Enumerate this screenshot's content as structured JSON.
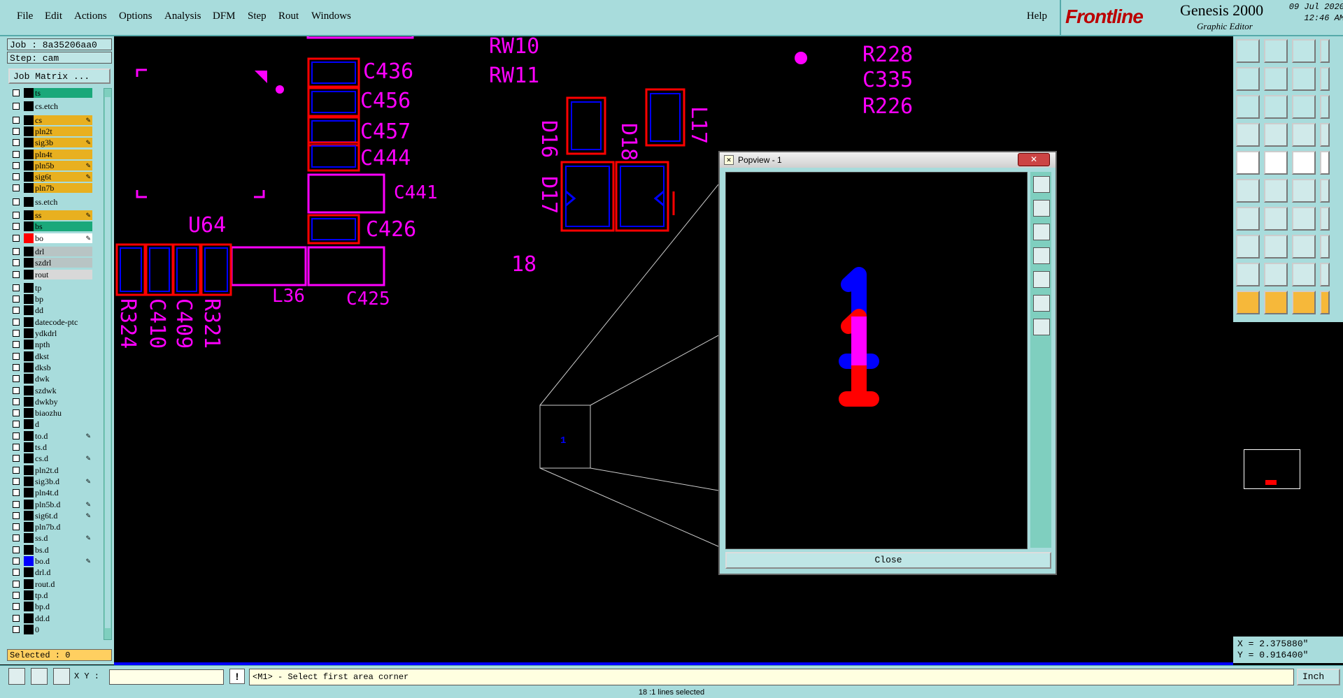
{
  "menu": [
    "File",
    "Edit",
    "Actions",
    "Options",
    "Analysis",
    "DFM",
    "Step",
    "Rout",
    "Windows"
  ],
  "help": "Help",
  "brand": {
    "logo": "Frontline",
    "title": "Genesis 2000",
    "subtitle": "Graphic Editor",
    "date": "09 Jul 2020",
    "time": "12:46 AM"
  },
  "job": {
    "job_label": "Job : 8a35206aa0",
    "step_label": "Step: cam",
    "matrix_button": "Job Matrix ..."
  },
  "layers": [
    {
      "name": "ts",
      "color": "#1aa87a",
      "sw": "#000000"
    },
    {
      "name": "cs.etch",
      "color": "#a8dcdc",
      "sw": "#000000"
    },
    {
      "name": "cs",
      "color": "#e8b020",
      "sw": "#000000",
      "edit": true
    },
    {
      "name": "pln2t",
      "color": "#e8b020",
      "sw": "#000000"
    },
    {
      "name": "sig3b",
      "color": "#e8b020",
      "sw": "#000000",
      "edit": true
    },
    {
      "name": "pln4t",
      "color": "#e8b020",
      "sw": "#000000"
    },
    {
      "name": "pln5b",
      "color": "#e8b020",
      "sw": "#000000",
      "edit": true
    },
    {
      "name": "sig6t",
      "color": "#e8b020",
      "sw": "#000000",
      "edit": true
    },
    {
      "name": "pln7b",
      "color": "#e8b020",
      "sw": "#000000"
    },
    {
      "name": "ss.etch",
      "color": "#a8dcdc",
      "sw": "#000000"
    },
    {
      "name": "ss",
      "color": "#e8b020",
      "sw": "#000000",
      "edit": true
    },
    {
      "name": "bs",
      "color": "#1aa87a",
      "sw": "#000000"
    },
    {
      "name": "bo",
      "color": "#ffffff",
      "sw": "#ff0000",
      "edit": true
    },
    {
      "name": "drl",
      "color": "#b8c4c4",
      "sw": "#000000"
    },
    {
      "name": "szdrl",
      "color": "#b8c4c4",
      "sw": "#000000"
    },
    {
      "name": "rout",
      "color": "#d8d8d8",
      "sw": "#000000"
    },
    {
      "name": "tp",
      "color": "#a8dcdc",
      "sw": "#000000"
    },
    {
      "name": "bp",
      "color": "#a8dcdc",
      "sw": "#000000"
    },
    {
      "name": "dd",
      "color": "#a8dcdc",
      "sw": "#000000"
    },
    {
      "name": "datecode-ptc",
      "color": "#a8dcdc",
      "sw": "#000000"
    },
    {
      "name": "ydkdrl",
      "color": "#a8dcdc",
      "sw": "#000000"
    },
    {
      "name": "npth",
      "color": "#a8dcdc",
      "sw": "#000000"
    },
    {
      "name": "dkst",
      "color": "#a8dcdc",
      "sw": "#000000"
    },
    {
      "name": "dksb",
      "color": "#a8dcdc",
      "sw": "#000000"
    },
    {
      "name": "dwk",
      "color": "#a8dcdc",
      "sw": "#000000"
    },
    {
      "name": "szdwk",
      "color": "#a8dcdc",
      "sw": "#000000"
    },
    {
      "name": "dwkby",
      "color": "#a8dcdc",
      "sw": "#000000"
    },
    {
      "name": "biaozhu",
      "color": "#a8dcdc",
      "sw": "#000000"
    },
    {
      "name": "d",
      "color": "#a8dcdc",
      "sw": "#000000"
    },
    {
      "name": "to.d",
      "color": "#a8dcdc",
      "sw": "#000000",
      "edit": true
    },
    {
      "name": "ts.d",
      "color": "#a8dcdc",
      "sw": "#000000"
    },
    {
      "name": "cs.d",
      "color": "#a8dcdc",
      "sw": "#000000",
      "edit": true
    },
    {
      "name": "pln2t.d",
      "color": "#a8dcdc",
      "sw": "#000000"
    },
    {
      "name": "sig3b.d",
      "color": "#a8dcdc",
      "sw": "#000000",
      "edit": true
    },
    {
      "name": "pln4t.d",
      "color": "#a8dcdc",
      "sw": "#000000"
    },
    {
      "name": "pln5b.d",
      "color": "#a8dcdc",
      "sw": "#000000",
      "edit": true
    },
    {
      "name": "sig6t.d",
      "color": "#a8dcdc",
      "sw": "#000000",
      "edit": true
    },
    {
      "name": "pln7b.d",
      "color": "#a8dcdc",
      "sw": "#000000"
    },
    {
      "name": "ss.d",
      "color": "#a8dcdc",
      "sw": "#000000",
      "edit": true
    },
    {
      "name": "bs.d",
      "color": "#a8dcdc",
      "sw": "#000000"
    },
    {
      "name": "bo.d",
      "color": "#a8dcdc",
      "sw": "#0000ff",
      "edit": true
    },
    {
      "name": "drl.d",
      "color": "#a8dcdc",
      "sw": "#000000"
    },
    {
      "name": "rout.d",
      "color": "#a8dcdc",
      "sw": "#000000"
    },
    {
      "name": "tp.d",
      "color": "#a8dcdc",
      "sw": "#000000"
    },
    {
      "name": "bp.d",
      "color": "#a8dcdc",
      "sw": "#000000"
    },
    {
      "name": "dd.d",
      "color": "#a8dcdc",
      "sw": "#000000"
    },
    {
      "name": "0",
      "color": "#a8dcdc",
      "sw": "#000000"
    }
  ],
  "selected": "Selected : 0",
  "canvas_labels": {
    "top": [
      "RW10",
      "RW11",
      "R228",
      "C335",
      "R226"
    ],
    "caps": [
      "C436",
      "C456",
      "C457",
      "C444",
      "C441",
      "C426",
      "C425"
    ],
    "left": [
      "U64",
      "L36",
      "R324",
      "C410",
      "C409",
      "R321"
    ],
    "mid": [
      "D16",
      "D17",
      "D18",
      "L17",
      "18"
    ]
  },
  "popview": {
    "title": "Popview - 1",
    "close": "Close"
  },
  "coords": {
    "x": "X = 2.375880\"",
    "y": "Y = 0.916400\""
  },
  "bottom": {
    "xy_label": "X Y :",
    "xy_value": "",
    "prompt": "<M1> - Select first area corner",
    "warn": "!",
    "units": "Inch"
  },
  "status": "18 :1 lines selected"
}
